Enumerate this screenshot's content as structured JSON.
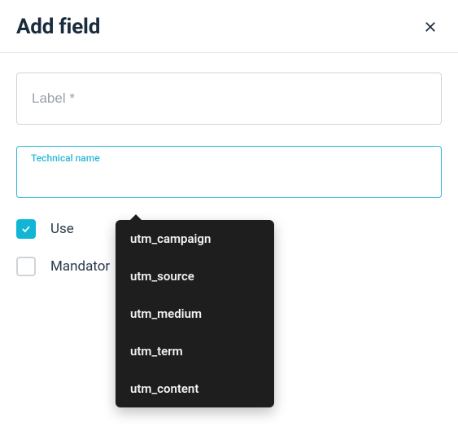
{
  "header": {
    "title": "Add field"
  },
  "fields": {
    "label": {
      "placeholder": "Label *",
      "value": ""
    },
    "technical_name": {
      "floating_label": "Technical name",
      "value": ""
    }
  },
  "checkboxes": {
    "use": {
      "label": "Use",
      "checked": true
    },
    "mandatory": {
      "label": "Mandator",
      "checked": false
    }
  },
  "dropdown": {
    "items": [
      "utm_campaign",
      "utm_source",
      "utm_medium",
      "utm_term",
      "utm_content"
    ]
  },
  "colors": {
    "accent": "#11b5d6",
    "focus_border": "#2bb8d6",
    "dropdown_bg": "#1e1e1e"
  }
}
